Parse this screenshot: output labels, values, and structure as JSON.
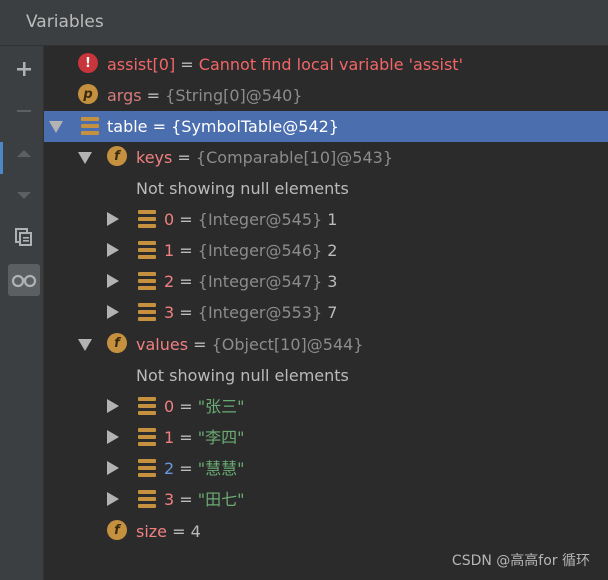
{
  "panel": {
    "title": "Variables"
  },
  "toolbar": {
    "buttons": [
      {
        "name": "add-watch",
        "icon": "plus-icon"
      },
      {
        "name": "remove-watch",
        "icon": "minus-icon"
      },
      {
        "name": "move-up",
        "icon": "up-triangle-icon"
      },
      {
        "name": "move-down",
        "icon": "down-triangle-icon"
      },
      {
        "name": "copy",
        "icon": "copy-icon"
      },
      {
        "name": "show-values",
        "icon": "glasses-icon"
      }
    ]
  },
  "colors": {
    "background": "#2b2b2b",
    "selection": "#4b6eaf",
    "error": "#f26667",
    "field_icon": "#c6913f",
    "string": "#6aab73"
  },
  "rows": [
    {
      "name": "assist[0]",
      "eq": " = ",
      "message": "Cannot find local variable 'assist'"
    },
    {
      "name": "args",
      "eq": " = ",
      "type": "{String[0]@540}"
    },
    {
      "name": "table",
      "eq": " = ",
      "type": "{SymbolTable@542}"
    },
    {
      "name": "keys",
      "eq": " = ",
      "type": "{Comparable[10]@543}"
    },
    {
      "note": "Not showing null elements"
    },
    {
      "name": "0",
      "eq": " = ",
      "type": "{Integer@545}",
      "value": " 1"
    },
    {
      "name": "1",
      "eq": " = ",
      "type": "{Integer@546}",
      "value": " 2"
    },
    {
      "name": "2",
      "eq": " = ",
      "type": "{Integer@547}",
      "value": " 3"
    },
    {
      "name": "3",
      "eq": " = ",
      "type": "{Integer@553}",
      "value": " 7"
    },
    {
      "name": "values",
      "eq": " = ",
      "type": "{Object[10]@544}"
    },
    {
      "note": "Not showing null elements"
    },
    {
      "name": "0",
      "eq": " = ",
      "value": "\"张三\""
    },
    {
      "name": "1",
      "eq": " = ",
      "value": "\"李四\""
    },
    {
      "name": "2",
      "eq": " = ",
      "value": "\"慧慧\""
    },
    {
      "name": "3",
      "eq": " = ",
      "value": "\"田七\""
    },
    {
      "name": "size",
      "eq": " = ",
      "value": "4"
    }
  ],
  "watermark": "CSDN @高高for 循环"
}
